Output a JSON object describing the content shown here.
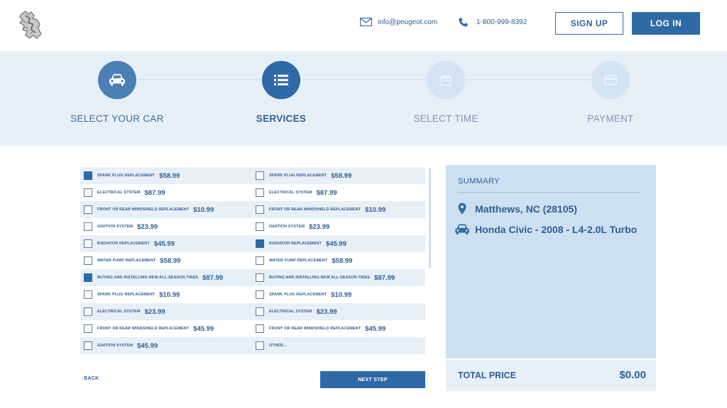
{
  "header": {
    "email": "info@peugeot.com",
    "phone": "1-800-999-8392",
    "signup_label": "SIGN UP",
    "login_label": "LOG IN"
  },
  "steps": [
    {
      "label": "SELECT YOUR CAR",
      "state": "done",
      "icon": "car-icon"
    },
    {
      "label": "SERVICES",
      "state": "active",
      "icon": "list-icon"
    },
    {
      "label": "SELECT TIME",
      "state": "pending",
      "icon": "calendar-icon"
    },
    {
      "label": "PAYMENT",
      "state": "pending",
      "icon": "card-icon"
    }
  ],
  "services": {
    "rows": [
      [
        {
          "name": "SPARK PLUG REPLACEMENT",
          "price": "$58.99",
          "checked": true
        },
        {
          "name": "SPARK PLUG REPLACEMENT",
          "price": "$58.99",
          "checked": false
        }
      ],
      [
        {
          "name": "ELECTRICAL SYSTEM",
          "price": "$87.99",
          "checked": false
        },
        {
          "name": "ELECTRICAL SYSTEM",
          "price": "$87.99",
          "checked": false
        }
      ],
      [
        {
          "name": "FRONT OR REAR WINDSHIELD REPLACEMENT",
          "price": "$10.99",
          "checked": false
        },
        {
          "name": "FRONT OR REAR WINDSHIELD REPLACEMENT",
          "price": "$10.99",
          "checked": false
        }
      ],
      [
        {
          "name": "IGNITION SYSTEM",
          "price": "$23.99",
          "checked": false
        },
        {
          "name": "IGNITION SYSTEM",
          "price": "$23.99",
          "checked": false
        }
      ],
      [
        {
          "name": "RADIATOR REPLACEMENT",
          "price": "$45.99",
          "checked": false
        },
        {
          "name": "RADIATOR REPLACEMENT",
          "price": "$45.99",
          "checked": true
        }
      ],
      [
        {
          "name": "WATER PUMP REPLACEMENT",
          "price": "$58.99",
          "checked": false
        },
        {
          "name": "WATER PUMP REPLACEMENT",
          "price": "$58.99",
          "checked": false
        }
      ],
      [
        {
          "name": "BUYING AND INSTALLING NEW ALL-SEASON TIRES",
          "price": "$87.99",
          "checked": true
        },
        {
          "name": "BUYING AND INSTALLING NEW ALL-SEASON TIRES",
          "price": "$87.99",
          "checked": false
        }
      ],
      [
        {
          "name": "SPARK PLUG REPLACEMENT",
          "price": "$10.99",
          "checked": false
        },
        {
          "name": "SPARK PLUG REPLACEMENT",
          "price": "$10.99",
          "checked": false
        }
      ],
      [
        {
          "name": "ELECTRICAL SYSTEM",
          "price": "$23.99",
          "checked": false
        },
        {
          "name": "ELECTRICAL SYSTEM",
          "price": "$23.99",
          "checked": false
        }
      ],
      [
        {
          "name": "FRONT OR REAR WINDSHIELD REPLACEMENT",
          "price": "$45.99",
          "checked": false
        },
        {
          "name": "FRONT OR REAR WINDSHIELD REPLACEMENT",
          "price": "$45.99",
          "checked": false
        }
      ],
      [
        {
          "name": "IGNITION SYSTEM",
          "price": "$45.99",
          "checked": false
        },
        {
          "name": "OTHER...",
          "price": "",
          "checked": false
        }
      ]
    ]
  },
  "nav": {
    "back_label": "BACK",
    "next_label": "NEXT STEP"
  },
  "summary": {
    "title": "SUMMARY",
    "location": "Matthews, NC (28105)",
    "car": "Honda Civic - 2008 - L4-2.0L Turbo",
    "total_label": "TOTAL PRICE",
    "total_value": "$0.00"
  },
  "colors": {
    "brand": "#2e6aa6",
    "band": "#e7eff7",
    "summary_bg": "#cce0f2"
  }
}
